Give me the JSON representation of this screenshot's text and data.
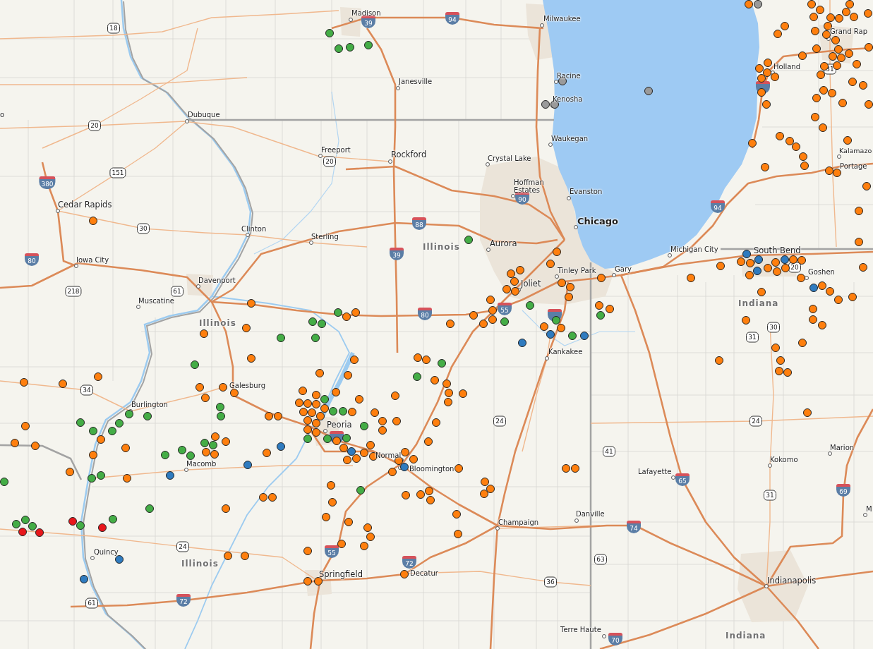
{
  "map": {
    "cities": [
      "Madison",
      "Milwaukee",
      "Grand Rap",
      "Holland",
      "Racine",
      "Janesville",
      "Kenosha",
      "o",
      "Dubuque",
      "Waukegan",
      "Freeport",
      "Kalamazo",
      "Rockford",
      "Crystal Lake",
      "Portage",
      "Hoffman Estates",
      "Evanston",
      "Cedar Rapids",
      "Chicago",
      "Clinton",
      "Sterling",
      "Aurora",
      "Michigan City",
      "South Bend",
      "Iowa City",
      "Tinley Park",
      "Gary",
      "Goshen",
      "Davenport",
      "Joliet",
      "Muscatine",
      "Kankakee",
      "Galesburg",
      "Burlington",
      "Peoria",
      "Marion",
      "Normal",
      "Kokomo",
      "Macomb",
      "Bloomington",
      "Lafayette",
      "M",
      "Danville",
      "Champaign",
      "Quincy",
      "Decatur",
      "Springfield",
      "Indianapolis",
      "Terre Haute"
    ],
    "state_labels": [
      "Illinois",
      "Illinois",
      "Indiana",
      "Illinois",
      "Indiana"
    ],
    "interstate_shields": [
      "39",
      "94",
      "380",
      "80",
      "88",
      "39",
      "90",
      "94",
      "80",
      "55",
      "55",
      "72",
      "72",
      "74",
      "65",
      "69",
      "70"
    ],
    "us_route_shields": [
      "18",
      "20",
      "151",
      "30",
      "218",
      "61",
      "20",
      "34",
      "24",
      "61",
      "24",
      "41",
      "63",
      "36",
      "30",
      "31",
      "24",
      "31",
      "20",
      "31"
    ],
    "markers": [
      {
        "color": "#ff7f0e"
      },
      {
        "color": "#ff7f0e"
      },
      {
        "color": "#ff7f0e"
      },
      {
        "color": "#44ad46"
      },
      {
        "color": "#44ad46"
      },
      {
        "color": "#44ad46"
      },
      {
        "color": "#44ad46"
      },
      {
        "color": "#9a9a9a"
      },
      {
        "color": "#9a9a9a"
      },
      {
        "color": "#9a9a9a"
      },
      {
        "color": "#44ad46"
      },
      {
        "color": "#ff7f0e"
      },
      {
        "color": "#ff7f0e"
      },
      {
        "color": "#ff7f0e"
      },
      {
        "color": "#ff7f0e"
      },
      {
        "color": "#ff7f0e"
      },
      {
        "color": "#ff7f0e"
      },
      {
        "color": "#ff7f0e"
      },
      {
        "color": "#ff7f0e"
      },
      {
        "color": "#ff7f0e"
      },
      {
        "color": "#ff7f0e"
      },
      {
        "color": "#44ad46"
      },
      {
        "color": "#ff7f0e"
      },
      {
        "color": "#ff7f0e"
      },
      {
        "color": "#ff7f0e"
      },
      {
        "color": "#ff7f0e"
      },
      {
        "color": "#ff7f0e"
      },
      {
        "color": "#ff7f0e"
      },
      {
        "color": "#44ad46"
      },
      {
        "color": "#ff7f0e"
      },
      {
        "color": "#44ad46"
      },
      {
        "color": "#44ad46"
      },
      {
        "color": "#ff7f0e"
      },
      {
        "color": "#44ad46"
      },
      {
        "color": "#ff7f0e"
      },
      {
        "color": "#ff7f0e"
      },
      {
        "color": "#44ad46"
      },
      {
        "color": "#ff7f0e"
      },
      {
        "color": "#9a9a9a"
      },
      {
        "color": "#ff7f0e"
      },
      {
        "color": "#ff7f0e"
      },
      {
        "color": "#ff7f0e"
      },
      {
        "color": "#ff7f0e"
      },
      {
        "color": "#ff7f0e"
      },
      {
        "color": "#ff7f0e"
      },
      {
        "color": "#ff7f0e"
      },
      {
        "color": "#ff7f0e"
      },
      {
        "color": "#ff7f0e"
      },
      {
        "color": "#ff7f0e"
      },
      {
        "color": "#ff7f0e"
      },
      {
        "color": "#ff7f0e"
      },
      {
        "color": "#ff7f0e"
      },
      {
        "color": "#ff7f0e"
      },
      {
        "color": "#ff7f0e"
      },
      {
        "color": "#ff7f0e"
      },
      {
        "color": "#ff7f0e"
      },
      {
        "color": "#ff7f0e"
      },
      {
        "color": "#ff7f0e"
      },
      {
        "color": "#ff7f0e"
      },
      {
        "color": "#ff7f0e"
      },
      {
        "color": "#ff7f0e"
      },
      {
        "color": "#ff7f0e"
      },
      {
        "color": "#ff7f0e"
      },
      {
        "color": "#ff7f0e"
      },
      {
        "color": "#ff7f0e"
      },
      {
        "color": "#ff7f0e"
      },
      {
        "color": "#ff7f0e"
      },
      {
        "color": "#ff7f0e"
      },
      {
        "color": "#ff7f0e"
      },
      {
        "color": "#ff7f0e"
      },
      {
        "color": "#ff7f0e"
      },
      {
        "color": "#ff7f0e"
      },
      {
        "color": "#ff7f0e"
      },
      {
        "color": "#9a9a9a"
      },
      {
        "color": "#ff7f0e"
      },
      {
        "color": "#ff7f0e"
      },
      {
        "color": "#ff7f0e"
      },
      {
        "color": "#ff7f0e"
      },
      {
        "color": "#ff7f0e"
      },
      {
        "color": "#ff7f0e"
      },
      {
        "color": "#ff7f0e"
      },
      {
        "color": "#ff7f0e"
      },
      {
        "color": "#ff7f0e"
      },
      {
        "color": "#ff7f0e"
      },
      {
        "color": "#ff7f0e"
      },
      {
        "color": "#ff7f0e"
      },
      {
        "color": "#ff7f0e"
      },
      {
        "color": "#ff7f0e"
      },
      {
        "color": "#ff7f0e"
      },
      {
        "color": "#ff7f0e"
      },
      {
        "color": "#ff7f0e"
      },
      {
        "color": "#ff7f0e"
      },
      {
        "color": "#ff7f0e"
      },
      {
        "color": "#ff7f0e"
      },
      {
        "color": "#ff7f0e"
      },
      {
        "color": "#2f7bbf"
      },
      {
        "color": "#ff7f0e"
      },
      {
        "color": "#ff7f0e"
      },
      {
        "color": "#2f7bbf"
      },
      {
        "color": "#ff7f0e"
      },
      {
        "color": "#ff7f0e"
      },
      {
        "color": "#ff7f0e"
      },
      {
        "color": "#ff7f0e"
      },
      {
        "color": "#ff7f0e"
      },
      {
        "color": "#2f7bbf"
      },
      {
        "color": "#ff7f0e"
      },
      {
        "color": "#ff7f0e"
      },
      {
        "color": "#2f7bbf"
      },
      {
        "color": "#ff7f0e"
      },
      {
        "color": "#ff7f0e"
      },
      {
        "color": "#ff7f0e"
      },
      {
        "color": "#ff7f0e"
      },
      {
        "color": "#ff7f0e"
      },
      {
        "color": "#2f7bbf"
      },
      {
        "color": "#ff7f0e"
      },
      {
        "color": "#ff7f0e"
      },
      {
        "color": "#ff7f0e"
      },
      {
        "color": "#ff7f0e"
      },
      {
        "color": "#ff7f0e"
      },
      {
        "color": "#ff7f0e"
      },
      {
        "color": "#ff7f0e"
      },
      {
        "color": "#ff7f0e"
      },
      {
        "color": "#44ad46"
      },
      {
        "color": "#ff7f0e"
      },
      {
        "color": "#ff7f0e"
      },
      {
        "color": "#ff7f0e"
      },
      {
        "color": "#2f7bbf"
      },
      {
        "color": "#ff7f0e"
      },
      {
        "color": "#ff7f0e"
      },
      {
        "color": "#ff7f0e"
      },
      {
        "color": "#ff7f0e"
      },
      {
        "color": "#ff7f0e"
      },
      {
        "color": "#ff7f0e"
      },
      {
        "color": "#ff7f0e"
      },
      {
        "color": "#44ad46"
      },
      {
        "color": "#2f7bbf"
      },
      {
        "color": "#44ad46"
      },
      {
        "color": "#2f7bbf"
      },
      {
        "color": "#ff7f0e"
      },
      {
        "color": "#ff7f0e"
      },
      {
        "color": "#ff7f0e"
      },
      {
        "color": "#44ad46"
      },
      {
        "color": "#ff7f0e"
      },
      {
        "color": "#ff7f0e"
      },
      {
        "color": "#44ad46"
      },
      {
        "color": "#ff7f0e"
      },
      {
        "color": "#ff7f0e"
      },
      {
        "color": "#ff7f0e"
      },
      {
        "color": "#ff7f0e"
      },
      {
        "color": "#ff7f0e"
      },
      {
        "color": "#ff7f0e"
      },
      {
        "color": "#ff7f0e"
      },
      {
        "color": "#44ad46"
      },
      {
        "color": "#ff7f0e"
      },
      {
        "color": "#ff7f0e"
      },
      {
        "color": "#ff7f0e"
      },
      {
        "color": "#ff7f0e"
      },
      {
        "color": "#ff7f0e"
      },
      {
        "color": "#ff7f0e"
      },
      {
        "color": "#ff7f0e"
      },
      {
        "color": "#ff7f0e"
      },
      {
        "color": "#ff7f0e"
      },
      {
        "color": "#ff7f0e"
      },
      {
        "color": "#ff7f0e"
      },
      {
        "color": "#ff7f0e"
      },
      {
        "color": "#ff7f0e"
      },
      {
        "color": "#ff7f0e"
      },
      {
        "color": "#44ad46"
      },
      {
        "color": "#44ad46"
      },
      {
        "color": "#ff7f0e"
      },
      {
        "color": "#ff7f0e"
      },
      {
        "color": "#44ad46"
      },
      {
        "color": "#44ad46"
      },
      {
        "color": "#ff7f0e"
      },
      {
        "color": "#ff7f0e"
      },
      {
        "color": "#ff7f0e"
      },
      {
        "color": "#ff7f0e"
      },
      {
        "color": "#44ad46"
      },
      {
        "color": "#44ad46"
      },
      {
        "color": "#ff7f0e"
      },
      {
        "color": "#ff7f0e"
      },
      {
        "color": "#ff7f0e"
      },
      {
        "color": "#ff7f0e"
      },
      {
        "color": "#2f7bbf"
      },
      {
        "color": "#ff7f0e"
      },
      {
        "color": "#ff7f0e"
      },
      {
        "color": "#ff7f0e"
      },
      {
        "color": "#ff7f0e"
      },
      {
        "color": "#ff7f0e"
      },
      {
        "color": "#ff7f0e"
      },
      {
        "color": "#ff7f0e"
      },
      {
        "color": "#2f7bbf"
      },
      {
        "color": "#ff7f0e"
      },
      {
        "color": "#ff7f0e"
      },
      {
        "color": "#ff7f0e"
      },
      {
        "color": "#ff7f0e"
      },
      {
        "color": "#ff7f0e"
      },
      {
        "color": "#ff7f0e"
      },
      {
        "color": "#ff7f0e"
      },
      {
        "color": "#ff7f0e"
      },
      {
        "color": "#44ad46"
      },
      {
        "color": "#ff7f0e"
      },
      {
        "color": "#ff7f0e"
      },
      {
        "color": "#ff7f0e"
      },
      {
        "color": "#ff7f0e"
      },
      {
        "color": "#ff7f0e"
      },
      {
        "color": "#ff7f0e"
      },
      {
        "color": "#ff7f0e"
      },
      {
        "color": "#ff7f0e"
      },
      {
        "color": "#ff7f0e"
      },
      {
        "color": "#ff7f0e"
      },
      {
        "color": "#ff7f0e"
      },
      {
        "color": "#ff7f0e"
      },
      {
        "color": "#ff7f0e"
      },
      {
        "color": "#ff7f0e"
      },
      {
        "color": "#ff7f0e"
      },
      {
        "color": "#ff7f0e"
      },
      {
        "color": "#ff7f0e"
      },
      {
        "color": "#ff7f0e"
      },
      {
        "color": "#44ad46"
      },
      {
        "color": "#44ad46"
      },
      {
        "color": "#ff7f0e"
      },
      {
        "color": "#ff7f0e"
      },
      {
        "color": "#ff7f0e"
      },
      {
        "color": "#ff7f0e"
      },
      {
        "color": "#ff7f0e"
      },
      {
        "color": "#ff7f0e"
      },
      {
        "color": "#ff7f0e"
      },
      {
        "color": "#ff7f0e"
      },
      {
        "color": "#44ad46"
      },
      {
        "color": "#44ad46"
      },
      {
        "color": "#ff7f0e"
      },
      {
        "color": "#ff7f0e"
      },
      {
        "color": "#44ad46"
      },
      {
        "color": "#44ad46"
      },
      {
        "color": "#44ad46"
      },
      {
        "color": "#ff7f0e"
      },
      {
        "color": "#44ad46"
      },
      {
        "color": "#44ad46"
      },
      {
        "color": "#44ad46"
      },
      {
        "color": "#ff7f0e"
      },
      {
        "color": "#ff7f0e"
      },
      {
        "color": "#ff7f0e"
      },
      {
        "color": "#ff7f0e"
      },
      {
        "color": "#ff7f0e"
      },
      {
        "color": "#44ad46"
      },
      {
        "color": "#44ad46"
      },
      {
        "color": "#ff7f0e"
      },
      {
        "color": "#44ad46"
      },
      {
        "color": "#44ad46"
      },
      {
        "color": "#44ad46"
      },
      {
        "color": "#ff7f0e"
      },
      {
        "color": "#ff7f0e"
      },
      {
        "color": "#2f7bbf"
      },
      {
        "color": "#ff7f0e"
      },
      {
        "color": "#2f7bbf"
      },
      {
        "color": "#ff7f0e"
      },
      {
        "color": "#ff7f0e"
      },
      {
        "color": "#2f7bbf"
      },
      {
        "color": "#44ad46"
      },
      {
        "color": "#44ad46"
      },
      {
        "color": "#ff7f0e"
      },
      {
        "color": "#44ad46"
      },
      {
        "color": "#44ad46"
      },
      {
        "color": "#ff7f0e"
      },
      {
        "color": "#ff7f0e"
      },
      {
        "color": "#ff7f0e"
      },
      {
        "color": "#44ad46"
      },
      {
        "color": "#44ad46"
      },
      {
        "color": "#44ad46"
      },
      {
        "color": "#44ad46"
      },
      {
        "color": "#e8161b"
      },
      {
        "color": "#e8161b"
      },
      {
        "color": "#e8161b"
      },
      {
        "color": "#44ad46"
      },
      {
        "color": "#e8161b"
      },
      {
        "color": "#2f7bbf"
      },
      {
        "color": "#2f7bbf"
      },
      {
        "color": "#ff7f0e"
      },
      {
        "color": "#ff7f0e"
      }
    ]
  }
}
